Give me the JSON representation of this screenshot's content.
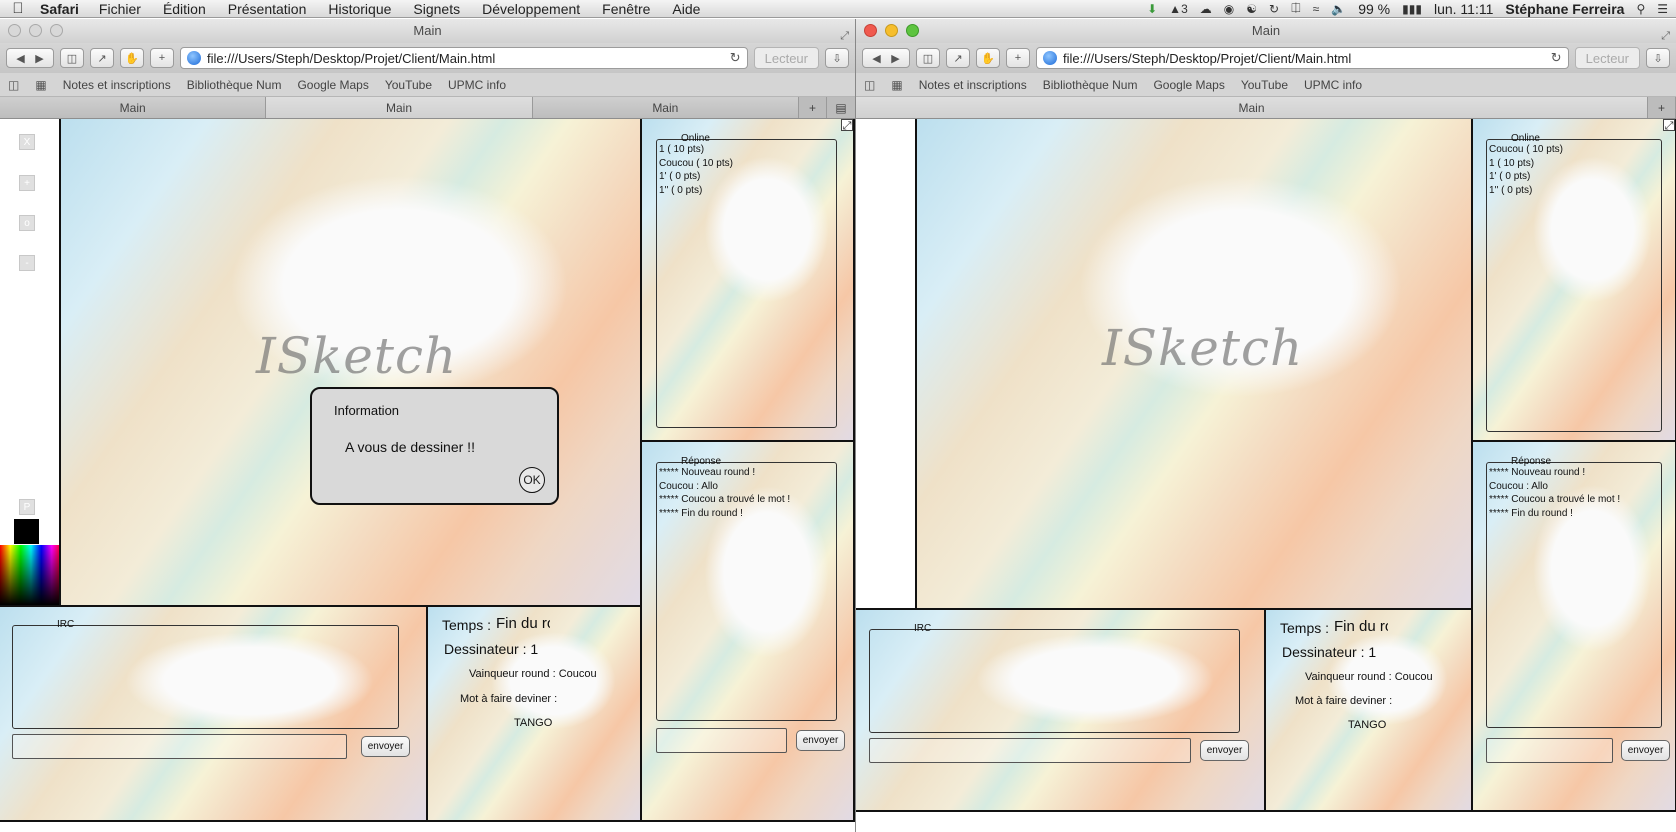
{
  "menubar": {
    "app": "Safari",
    "menus": [
      "Fichier",
      "Édition",
      "Présentation",
      "Historique",
      "Signets",
      "Développement",
      "Fenêtre",
      "Aide"
    ],
    "adobe_count": "3",
    "battery": "99 %",
    "clock": "lun. 11:11",
    "user": "Stéphane Ferreira"
  },
  "left_window": {
    "title": "Main",
    "url": "file:///Users/Steph/Desktop/Projet/Client/Main.html",
    "reader": "Lecteur",
    "bookmarks": [
      "Notes et inscriptions",
      "Bibliothèque Num",
      "Google Maps",
      "YouTube",
      "UPMC info"
    ],
    "tabs": [
      "Main",
      "Main",
      "Main"
    ],
    "tools": [
      "X",
      "+",
      "o",
      "-"
    ],
    "p_label": "P",
    "logo": "ISketch",
    "online": {
      "legend": "Online",
      "players": [
        "1 ( 10 pts)",
        "Coucou ( 10 pts)",
        "1' ( 0 pts)",
        "1'' ( 0 pts)"
      ]
    },
    "reponse": {
      "legend": "Réponse",
      "messages": [
        "***** Nouveau round !",
        "Coucou : Allo",
        "***** Coucou a trouvé le mot !",
        "***** Fin du round !"
      ]
    },
    "reponse_button": "envoyer",
    "irc": {
      "legend": "IRC",
      "button": "envoyer"
    },
    "status": {
      "temps_label": "Temps :",
      "temps_value": "Fin du ro",
      "dessinateur": "Dessinateur : 1",
      "vainqueur": "Vainqueur round : Coucou",
      "mot_label": "Mot à faire deviner :",
      "mot": "TANGO"
    },
    "dialog": {
      "title": "Information",
      "message": "A vous de dessiner !!",
      "ok": "OK"
    }
  },
  "right_window": {
    "title": "Main",
    "url": "file:///Users/Steph/Desktop/Projet/Client/Main.html",
    "reader": "Lecteur",
    "bookmarks": [
      "Notes et inscriptions",
      "Bibliothèque Num",
      "Google Maps",
      "YouTube",
      "UPMC info"
    ],
    "tabs": [
      "Main"
    ],
    "logo": "ISketch",
    "online": {
      "legend": "Online",
      "players": [
        "Coucou ( 10 pts)",
        "1 ( 10 pts)",
        "1' ( 0 pts)",
        "1'' ( 0 pts)"
      ]
    },
    "reponse": {
      "legend": "Réponse",
      "messages": [
        "***** Nouveau round !",
        "Coucou : Allo",
        "***** Coucou a trouvé le mot !",
        "***** Fin du round !"
      ]
    },
    "reponse_button": "envoyer",
    "irc": {
      "legend": "IRC",
      "button": "envoyer"
    },
    "status": {
      "temps_label": "Temps :",
      "temps_value": "Fin du ro",
      "dessinateur": "Dessinateur : 1",
      "vainqueur": "Vainqueur round : Coucou",
      "mot_label": "Mot à faire deviner :",
      "mot": "TANGO"
    }
  }
}
